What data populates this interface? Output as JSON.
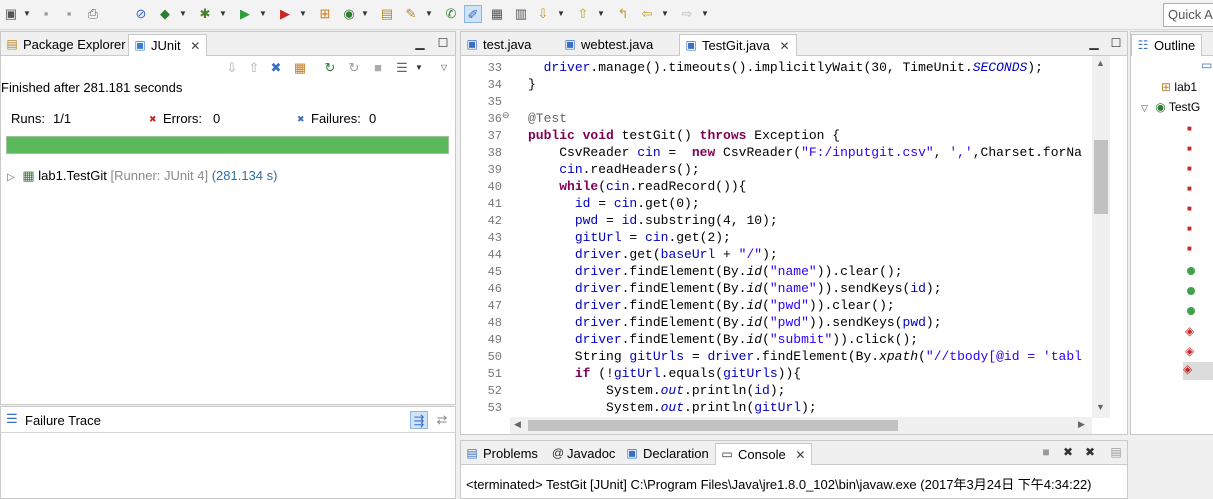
{
  "toolbar": {
    "quick_access_placeholder": "Quick Ac",
    "icons": [
      "new-icon",
      "save-icon",
      "save-all-icon",
      "print-icon",
      "skip-breakpoints-icon",
      "new-java-project-icon",
      "debug-icon",
      "run-icon",
      "run-external-icon",
      "new-package-icon",
      "new-class-icon",
      "open-type-icon",
      "search-icon",
      "annotation-icon",
      "highlight-icon",
      "whitespace-icon",
      "next-annotation-icon",
      "prev-annotation-icon",
      "last-edit-icon",
      "back-icon",
      "forward-icon"
    ]
  },
  "left_panel": {
    "tabs": [
      {
        "label": "Package Explorer"
      },
      {
        "label": "JUnit"
      }
    ],
    "status": "Finished after 281.181 seconds",
    "runs_label": "Runs:",
    "runs_value": "1/1",
    "errors_label": "Errors:",
    "errors_value": "0",
    "failures_label": "Failures:",
    "failures_value": "0",
    "progress_fraction": 1.0,
    "test_name": "lab1.TestGit",
    "test_runner": "[Runner: JUnit 4]",
    "test_time": "(281.134 s)",
    "failure_trace_label": "Failure Trace"
  },
  "editor": {
    "tabs": [
      {
        "label": "test.java"
      },
      {
        "label": "webtest.java"
      },
      {
        "label": "TestGit.java"
      }
    ],
    "line_numbers": [
      "33",
      "34",
      "35",
      "36",
      "37",
      "38",
      "39",
      "40",
      "41",
      "42",
      "43",
      "44",
      "45",
      "46",
      "47",
      "48",
      "49",
      "50",
      "51",
      "52",
      "53"
    ]
  },
  "bottom_panel": {
    "tabs": [
      {
        "label": "Problems"
      },
      {
        "label": "Javadoc"
      },
      {
        "label": "Declaration"
      },
      {
        "label": "Console"
      }
    ],
    "console_text": "<terminated> TestGit [JUnit] C:\\Program Files\\Java\\jre1.8.0_102\\bin\\javaw.exe (2017年3月24日 下午4:34:22)"
  },
  "outline": {
    "tab_label": "Outline",
    "items": [
      "lab1",
      "TestG"
    ]
  },
  "colors": {
    "progress_green": "#5cb85c",
    "keyword": "#7f0055",
    "string": "#2a00ff",
    "field": "#0000c0"
  }
}
